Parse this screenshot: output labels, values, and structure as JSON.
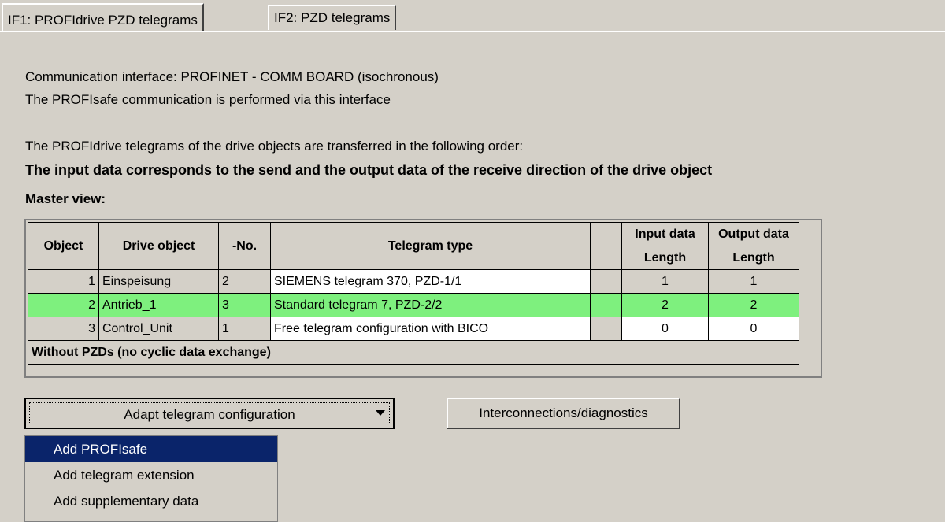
{
  "tabs": [
    {
      "label": "IF1:  PROFIdrive  PZD telegrams"
    },
    {
      "label": "IF2:  PZD telegrams"
    }
  ],
  "info": {
    "line1": "Communication interface: PROFINET - COMM BOARD (isochronous)",
    "line2": "The PROFIsafe communication is performed via this interface",
    "line3": "The PROFIdrive telegrams of the drive objects are transferred in the following order:",
    "bold_line": "The input data corresponds to the send and the output data of the receive direction of the drive object",
    "master_view": "Master view:"
  },
  "table": {
    "headers": {
      "object": "Object",
      "drive_object": "Drive object",
      "no": "-No.",
      "telegram_type": "Telegram type",
      "input_data": "Input data",
      "output_data": "Output data",
      "length_in": "Length",
      "length_out": "Length"
    },
    "rows": [
      {
        "object": "1",
        "drive_object": "Einspeisung",
        "no": "2",
        "telegram_type": "SIEMENS telegram 370, PZD-1/1",
        "input": "1",
        "output": "1"
      },
      {
        "object": "2",
        "drive_object": "Antrieb_1",
        "no": "3",
        "telegram_type": "Standard telegram 7, PZD-2/2",
        "input": "2",
        "output": "2"
      },
      {
        "object": "3",
        "drive_object": "Control_Unit",
        "no": "1",
        "telegram_type": "Free telegram configuration with BICO",
        "input": "0",
        "output": "0"
      }
    ],
    "footer": "Without PZDs (no cyclic data exchange)",
    "highlight_color": "#7ef07e"
  },
  "buttons": {
    "adapt": "Adapt telegram configuration",
    "interconnections": "Interconnections/diagnostics"
  },
  "menu": {
    "items": [
      "Add PROFIsafe",
      "Add telegram extension",
      "Add supplementary data"
    ],
    "selected_index": 0
  }
}
